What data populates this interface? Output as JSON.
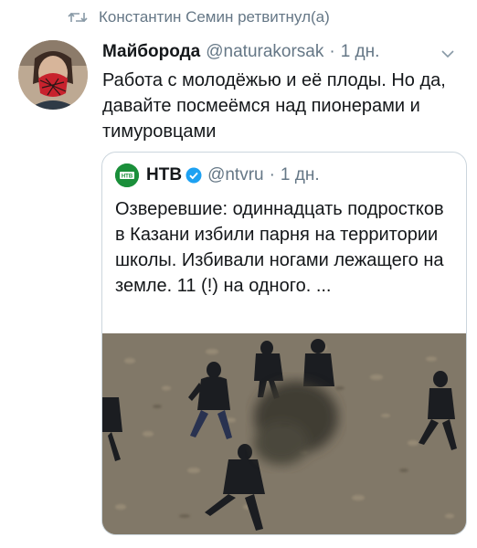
{
  "retweet": {
    "text": "Константин Семин ретвитнул(а)",
    "icon": "retweet-icon"
  },
  "tweet": {
    "author_name": "Майборода",
    "author_handle": "@naturakorsak",
    "separator": "·",
    "time": "1 дн.",
    "text": "Работа с молодёжью и её плоды. Но да, давайте посмеёмся над пионерами и тимуровцами",
    "menu_icon": "chevron-down-icon"
  },
  "quoted_tweet": {
    "author_name": "НТВ",
    "author_handle": "@ntvru",
    "separator": "·",
    "time": "1 дн.",
    "text": "Озверевшие: одиннадцать подростков в Казани избили парня на территории школы. Избивали ногами лежащего на земле. 11 (!) на одного. ...",
    "logo_text": "НТВ",
    "verified_icon": "verified-badge-icon"
  },
  "colors": {
    "text_primary": "#14171a",
    "text_secondary": "#657786",
    "border": "#ccd6dd",
    "verified_blue": "#1da1f2",
    "ntv_green": "#1a8f3a"
  }
}
